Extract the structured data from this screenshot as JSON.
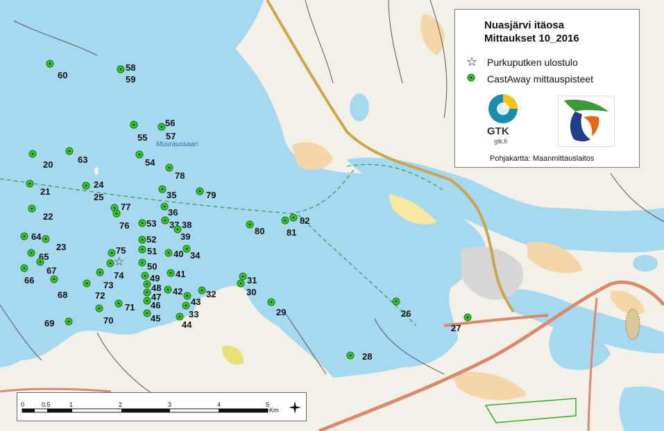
{
  "legend": {
    "title_line1": "Nuasjärvi itäosa",
    "title_line2": "Mittaukset 10_2016",
    "item_outlet": "Purkuputken ulostulo",
    "item_castaway": "CastAway mittauspisteet",
    "gtk_logo_text": "GTK",
    "gtk_logo_sub": "gtk.fi",
    "basemap_credit": "Pohjakartta: Maanmittauslaitos"
  },
  "map_labels": {
    "island_name": "Muuraussaari"
  },
  "scalebar": {
    "ticks": [
      "0",
      "0.5",
      "1",
      "2",
      "3",
      "4",
      "5"
    ],
    "unit": "Km"
  },
  "colors": {
    "water": "#a6d8f0",
    "land": "#f3f0e8",
    "point_fill": "#39c92a",
    "road": "#d98a6c",
    "highway": "#c8a64b"
  },
  "points": [
    {
      "id": "60",
      "label": "60"
    },
    {
      "id": "58",
      "label": "58"
    },
    {
      "id": "59",
      "label": "59"
    },
    {
      "id": "56",
      "label": "56"
    },
    {
      "id": "55",
      "label": "55"
    },
    {
      "id": "57",
      "label": "57"
    },
    {
      "id": "20",
      "label": "20"
    },
    {
      "id": "63",
      "label": "63"
    },
    {
      "id": "54",
      "label": "54"
    },
    {
      "id": "78",
      "label": "78"
    },
    {
      "id": "21",
      "label": "21"
    },
    {
      "id": "24",
      "label": "24"
    },
    {
      "id": "25",
      "label": "25"
    },
    {
      "id": "35",
      "label": "35"
    },
    {
      "id": "79",
      "label": "79"
    },
    {
      "id": "22",
      "label": "22"
    },
    {
      "id": "77",
      "label": "77"
    },
    {
      "id": "76",
      "label": "76"
    },
    {
      "id": "36",
      "label": "36"
    },
    {
      "id": "53",
      "label": "53"
    },
    {
      "id": "37",
      "label": "37"
    },
    {
      "id": "38",
      "label": "38"
    },
    {
      "id": "39",
      "label": "39"
    },
    {
      "id": "80",
      "label": "80"
    },
    {
      "id": "81",
      "label": "81"
    },
    {
      "id": "82",
      "label": "82"
    },
    {
      "id": "64",
      "label": "64"
    },
    {
      "id": "23",
      "label": "23"
    },
    {
      "id": "52",
      "label": "52"
    },
    {
      "id": "65",
      "label": "65"
    },
    {
      "id": "75",
      "label": "75"
    },
    {
      "id": "51",
      "label": "51"
    },
    {
      "id": "40",
      "label": "40"
    },
    {
      "id": "34",
      "label": "34"
    },
    {
      "id": "67",
      "label": "67"
    },
    {
      "id": "66",
      "label": "66"
    },
    {
      "id": "74",
      "label": "74"
    },
    {
      "id": "50",
      "label": "50"
    },
    {
      "id": "41",
      "label": "41"
    },
    {
      "id": "73",
      "label": "73"
    },
    {
      "id": "72",
      "label": "72"
    },
    {
      "id": "68",
      "label": "68"
    },
    {
      "id": "49",
      "label": "49"
    },
    {
      "id": "48",
      "label": "48"
    },
    {
      "id": "47",
      "label": "47"
    },
    {
      "id": "46",
      "label": "46"
    },
    {
      "id": "42",
      "label": "42"
    },
    {
      "id": "32",
      "label": "32"
    },
    {
      "id": "31",
      "label": "31"
    },
    {
      "id": "30",
      "label": "30"
    },
    {
      "id": "43",
      "label": "43"
    },
    {
      "id": "33",
      "label": "33"
    },
    {
      "id": "71",
      "label": "71"
    },
    {
      "id": "70",
      "label": "70"
    },
    {
      "id": "45",
      "label": "45"
    },
    {
      "id": "44",
      "label": "44"
    },
    {
      "id": "29",
      "label": "29"
    },
    {
      "id": "26",
      "label": "26"
    },
    {
      "id": "69",
      "label": "69"
    },
    {
      "id": "27",
      "label": "27"
    },
    {
      "id": "28",
      "label": "28"
    }
  ]
}
